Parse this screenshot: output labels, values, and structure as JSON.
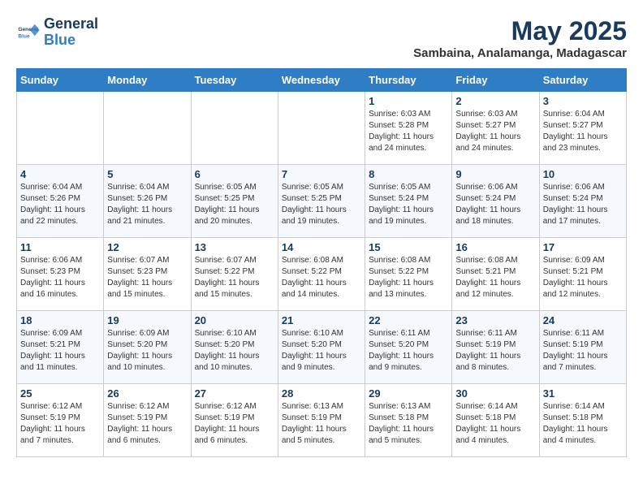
{
  "header": {
    "logo_line1": "General",
    "logo_line2": "Blue",
    "month": "May 2025",
    "location": "Sambaina, Analamanga, Madagascar"
  },
  "weekdays": [
    "Sunday",
    "Monday",
    "Tuesday",
    "Wednesday",
    "Thursday",
    "Friday",
    "Saturday"
  ],
  "weeks": [
    [
      {
        "day": "",
        "info": ""
      },
      {
        "day": "",
        "info": ""
      },
      {
        "day": "",
        "info": ""
      },
      {
        "day": "",
        "info": ""
      },
      {
        "day": "1",
        "info": "Sunrise: 6:03 AM\nSunset: 5:28 PM\nDaylight: 11 hours\nand 24 minutes."
      },
      {
        "day": "2",
        "info": "Sunrise: 6:03 AM\nSunset: 5:27 PM\nDaylight: 11 hours\nand 24 minutes."
      },
      {
        "day": "3",
        "info": "Sunrise: 6:04 AM\nSunset: 5:27 PM\nDaylight: 11 hours\nand 23 minutes."
      }
    ],
    [
      {
        "day": "4",
        "info": "Sunrise: 6:04 AM\nSunset: 5:26 PM\nDaylight: 11 hours\nand 22 minutes."
      },
      {
        "day": "5",
        "info": "Sunrise: 6:04 AM\nSunset: 5:26 PM\nDaylight: 11 hours\nand 21 minutes."
      },
      {
        "day": "6",
        "info": "Sunrise: 6:05 AM\nSunset: 5:25 PM\nDaylight: 11 hours\nand 20 minutes."
      },
      {
        "day": "7",
        "info": "Sunrise: 6:05 AM\nSunset: 5:25 PM\nDaylight: 11 hours\nand 19 minutes."
      },
      {
        "day": "8",
        "info": "Sunrise: 6:05 AM\nSunset: 5:24 PM\nDaylight: 11 hours\nand 19 minutes."
      },
      {
        "day": "9",
        "info": "Sunrise: 6:06 AM\nSunset: 5:24 PM\nDaylight: 11 hours\nand 18 minutes."
      },
      {
        "day": "10",
        "info": "Sunrise: 6:06 AM\nSunset: 5:24 PM\nDaylight: 11 hours\nand 17 minutes."
      }
    ],
    [
      {
        "day": "11",
        "info": "Sunrise: 6:06 AM\nSunset: 5:23 PM\nDaylight: 11 hours\nand 16 minutes."
      },
      {
        "day": "12",
        "info": "Sunrise: 6:07 AM\nSunset: 5:23 PM\nDaylight: 11 hours\nand 15 minutes."
      },
      {
        "day": "13",
        "info": "Sunrise: 6:07 AM\nSunset: 5:22 PM\nDaylight: 11 hours\nand 15 minutes."
      },
      {
        "day": "14",
        "info": "Sunrise: 6:08 AM\nSunset: 5:22 PM\nDaylight: 11 hours\nand 14 minutes."
      },
      {
        "day": "15",
        "info": "Sunrise: 6:08 AM\nSunset: 5:22 PM\nDaylight: 11 hours\nand 13 minutes."
      },
      {
        "day": "16",
        "info": "Sunrise: 6:08 AM\nSunset: 5:21 PM\nDaylight: 11 hours\nand 12 minutes."
      },
      {
        "day": "17",
        "info": "Sunrise: 6:09 AM\nSunset: 5:21 PM\nDaylight: 11 hours\nand 12 minutes."
      }
    ],
    [
      {
        "day": "18",
        "info": "Sunrise: 6:09 AM\nSunset: 5:21 PM\nDaylight: 11 hours\nand 11 minutes."
      },
      {
        "day": "19",
        "info": "Sunrise: 6:09 AM\nSunset: 5:20 PM\nDaylight: 11 hours\nand 10 minutes."
      },
      {
        "day": "20",
        "info": "Sunrise: 6:10 AM\nSunset: 5:20 PM\nDaylight: 11 hours\nand 10 minutes."
      },
      {
        "day": "21",
        "info": "Sunrise: 6:10 AM\nSunset: 5:20 PM\nDaylight: 11 hours\nand 9 minutes."
      },
      {
        "day": "22",
        "info": "Sunrise: 6:11 AM\nSunset: 5:20 PM\nDaylight: 11 hours\nand 9 minutes."
      },
      {
        "day": "23",
        "info": "Sunrise: 6:11 AM\nSunset: 5:19 PM\nDaylight: 11 hours\nand 8 minutes."
      },
      {
        "day": "24",
        "info": "Sunrise: 6:11 AM\nSunset: 5:19 PM\nDaylight: 11 hours\nand 7 minutes."
      }
    ],
    [
      {
        "day": "25",
        "info": "Sunrise: 6:12 AM\nSunset: 5:19 PM\nDaylight: 11 hours\nand 7 minutes."
      },
      {
        "day": "26",
        "info": "Sunrise: 6:12 AM\nSunset: 5:19 PM\nDaylight: 11 hours\nand 6 minutes."
      },
      {
        "day": "27",
        "info": "Sunrise: 6:12 AM\nSunset: 5:19 PM\nDaylight: 11 hours\nand 6 minutes."
      },
      {
        "day": "28",
        "info": "Sunrise: 6:13 AM\nSunset: 5:19 PM\nDaylight: 11 hours\nand 5 minutes."
      },
      {
        "day": "29",
        "info": "Sunrise: 6:13 AM\nSunset: 5:18 PM\nDaylight: 11 hours\nand 5 minutes."
      },
      {
        "day": "30",
        "info": "Sunrise: 6:14 AM\nSunset: 5:18 PM\nDaylight: 11 hours\nand 4 minutes."
      },
      {
        "day": "31",
        "info": "Sunrise: 6:14 AM\nSunset: 5:18 PM\nDaylight: 11 hours\nand 4 minutes."
      }
    ]
  ]
}
